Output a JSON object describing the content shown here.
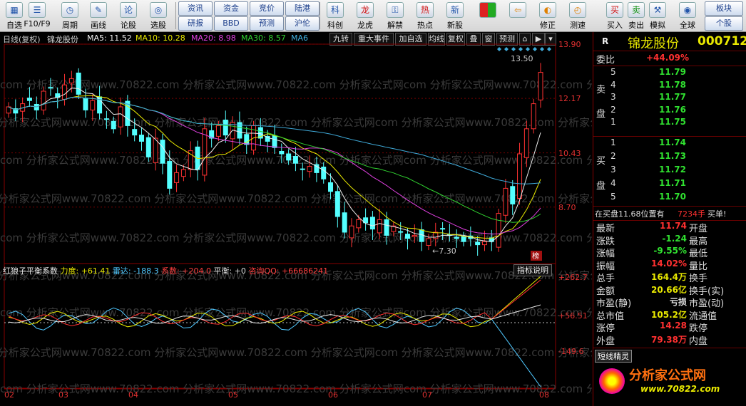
{
  "toolbar": {
    "buttons": [
      {
        "label": "自选",
        "icon": "grid-icon"
      },
      {
        "label": "F10/F9",
        "icon": "doc-icon"
      },
      {
        "label": "周期",
        "icon": "clock-icon"
      },
      {
        "label": "画线",
        "icon": "pen-icon"
      },
      {
        "label": "论股",
        "icon": "chat-icon"
      },
      {
        "label": "选股",
        "icon": "chart-search-icon"
      }
    ],
    "small_buttons": [
      [
        "资讯",
        "研报"
      ],
      [
        "资金",
        "BBD"
      ],
      [
        "竞价",
        "预测"
      ],
      [
        "陆港",
        "沪伦"
      ]
    ],
    "right_buttons": [
      {
        "label": "科创",
        "icon": "kechuang-icon"
      },
      {
        "label": "龙虎",
        "icon": "dragon-icon"
      },
      {
        "label": "解禁",
        "icon": "unlock-icon"
      },
      {
        "label": "热点",
        "icon": "hot-icon"
      },
      {
        "label": "新股",
        "icon": "ipo-icon"
      },
      {
        "label": "",
        "icon": "color-palette-icon"
      },
      {
        "label": "",
        "icon": "back-arrow-icon"
      },
      {
        "label": "修正",
        "icon": "fix-icon"
      },
      {
        "label": "测速",
        "icon": "speed-icon"
      },
      {
        "label": "买入",
        "icon": "buy-icon",
        "text": "买"
      },
      {
        "label": "卖出",
        "icon": "sell-icon",
        "text": "卖"
      },
      {
        "label": "模拟",
        "icon": "hammer-icon"
      },
      {
        "label": "全球",
        "icon": "globe-icon"
      }
    ],
    "far_right": [
      "板块",
      "个股"
    ]
  },
  "header": {
    "period": "日线(复权)",
    "stock": "锦龙股份",
    "ma5": "MA5: 11.52",
    "ma10": "MA10: 10.28",
    "ma20": "MA20: 8.98",
    "ma30": "MA30: 8.57",
    "ma6": "MA6",
    "tabs": [
      "九转",
      "重大事件",
      "加自选",
      "均线",
      "复权",
      "叠",
      "窗",
      "预测"
    ]
  },
  "indicator": {
    "name": "红狼子平衡系数",
    "force": "力度: +61.41",
    "radar": "雷达: -188.3",
    "coef": "系数: +204.0",
    "balance": "平衡: +0",
    "qq": "咨询QQ: +66686241",
    "help": "指标说明"
  },
  "price_axis": [
    "13.90",
    "12.17",
    "10.43",
    "8.70"
  ],
  "ind_axis": [
    "+262.7",
    "+56.51",
    "-149.6"
  ],
  "x_axis": [
    "02",
    "03",
    "04",
    "05",
    "06",
    "07",
    "08"
  ],
  "annotations": {
    "high": "13.50",
    "low": "7.30",
    "bang": "榜"
  },
  "watermark": "com 分析家公式网www.70822.com 分析家公式网www.70822.com 分析家公式网",
  "right_panel": {
    "r": "R",
    "name": "锦龙股份",
    "code": "000712",
    "weibi_label": "委比",
    "weibi": "+44.09%",
    "sell_label": [
      "卖",
      "盘"
    ],
    "sell": [
      [
        "5",
        "11.79"
      ],
      [
        "4",
        "11.78"
      ],
      [
        "3",
        "11.77"
      ],
      [
        "2",
        "11.76"
      ],
      [
        "1",
        "11.75"
      ]
    ],
    "buy_label": [
      "买",
      "盘"
    ],
    "buy": [
      [
        "1",
        "11.74"
      ],
      [
        "2",
        "11.73"
      ],
      [
        "3",
        "11.72"
      ],
      [
        "4",
        "11.71"
      ],
      [
        "5",
        "11.70"
      ]
    ],
    "notice_a": "在买盘11.68位置有",
    "notice_b": "7234手",
    "notice_c": "买单!",
    "stats": [
      [
        "最新",
        "11.74",
        "开盘",
        ""
      ],
      [
        "涨跌",
        "-1.24",
        "最高",
        ""
      ],
      [
        "涨幅",
        "-9.55%",
        "最低",
        ""
      ],
      [
        "振幅",
        "14.02%",
        "量比",
        ""
      ],
      [
        "总手",
        "164.4万",
        "换手",
        ""
      ],
      [
        "金额",
        "20.66亿",
        "换手(实)",
        ""
      ],
      [
        "市盈(静)",
        "亏损",
        "市盈(动)",
        ""
      ],
      [
        "总市值",
        "105.2亿",
        "流通值",
        ""
      ],
      [
        "涨停",
        "14.28",
        "跌停",
        ""
      ],
      [
        "外盘",
        "79.38万",
        "内盘",
        ""
      ]
    ],
    "short_tab": "短线精灵",
    "logo": "分析家公式网",
    "logo_url": "www.70822.com"
  },
  "chart_data": {
    "type": "candlestick",
    "ylim": [
      6.9,
      13.9
    ],
    "months": [
      "02",
      "03",
      "04",
      "05",
      "06",
      "07",
      "08"
    ],
    "closes": [
      11.9,
      11.7,
      12.0,
      12.1,
      11.8,
      12.4,
      12.5,
      12.2,
      12.6,
      12.8,
      12.3,
      11.8,
      12.1,
      11.7,
      11.5,
      11.2,
      11.9,
      11.3,
      11.0,
      10.8,
      10.3,
      10.9,
      10.1,
      9.3,
      9.8,
      9.9,
      10.5,
      9.9,
      11.2,
      10.9,
      11.3,
      11.0,
      11.4,
      10.9,
      10.7,
      11.3,
      10.9,
      10.8,
      10.6,
      10.4,
      10.2,
      10.1,
      9.9,
      10.0,
      9.8,
      9.6,
      9.2,
      8.4,
      7.9,
      8.1,
      8.3,
      8.2,
      8.0,
      8.3,
      7.8,
      8.1,
      7.9,
      7.7,
      7.8,
      7.6,
      7.7,
      7.9,
      8.0,
      7.8,
      7.7,
      7.6,
      7.7,
      7.5,
      7.6,
      7.6,
      8.5,
      9.3,
      8.8,
      10.4,
      11.2,
      12.0,
      13.0
    ]
  }
}
